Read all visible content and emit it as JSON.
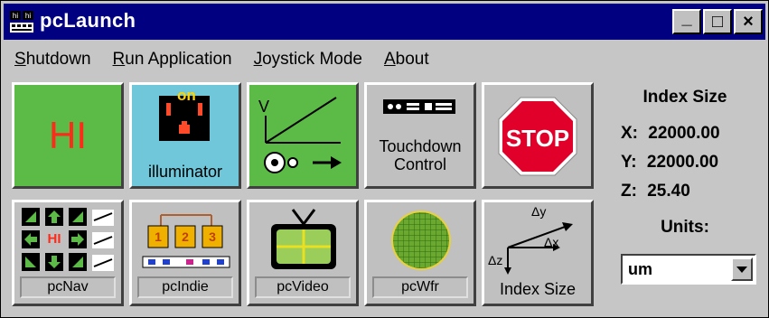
{
  "window": {
    "title": "pcLaunch",
    "icon": "pcLaunch-app-icon"
  },
  "titlebar_buttons": [
    {
      "name": "minimize",
      "glyph": "_"
    },
    {
      "name": "maximize",
      "glyph": "□"
    },
    {
      "name": "close",
      "glyph": "×"
    }
  ],
  "menu": [
    "Shutdown",
    "Run Application",
    "Joystick Mode",
    "About"
  ],
  "tools": {
    "hi": {
      "text": "HI",
      "color": "#5cba47",
      "text_color": "#ff2a1a"
    },
    "illuminator": {
      "label": "illuminator",
      "on_text": "on",
      "color": "#6fc7d9"
    },
    "joystick": {
      "axis_label": "V",
      "color": "#5cba47"
    },
    "touchdown": {
      "label_line1": "Touchdown",
      "label_line2": "Control"
    },
    "stop": {
      "text": "STOP",
      "color": "#e0002a"
    },
    "pcnav": {
      "label": "pcNav",
      "center_text": "HI"
    },
    "pcindie": {
      "label": "pcIndie",
      "digits": [
        "1",
        "2",
        "3"
      ]
    },
    "pcvideo": {
      "label": "pcVideo"
    },
    "pcwfr": {
      "label": "pcWfr"
    },
    "indexsize": {
      "label": "Index Size",
      "dy": "Δy",
      "dx": "Δx",
      "dz": "Δz"
    }
  },
  "index_size": {
    "title": "Index Size",
    "x_label": "X:",
    "x_value": "22000.00",
    "y_label": "Y:",
    "y_value": "22000.00",
    "z_label": "Z:",
    "z_value": "25.40",
    "units_label": "Units:",
    "units_value": "um"
  }
}
